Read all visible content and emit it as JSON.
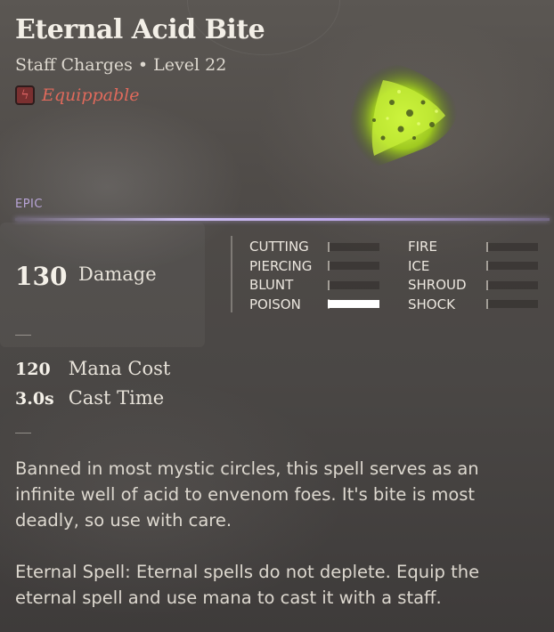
{
  "item": {
    "title": "Eternal Acid Bite",
    "subtitle": "Staff Charges • Level 22",
    "equippable_label": "Equippable",
    "rarity": "EPIC"
  },
  "damage": {
    "value": "130",
    "label": "Damage",
    "types_left": [
      {
        "label": "CUTTING",
        "fill": 0
      },
      {
        "label": "PIERCING",
        "fill": 0
      },
      {
        "label": "BLUNT",
        "fill": 0
      },
      {
        "label": "POISON",
        "fill": 1
      }
    ],
    "types_right": [
      {
        "label": "FIRE",
        "fill": 0
      },
      {
        "label": "ICE",
        "fill": 0
      },
      {
        "label": "SHROUD",
        "fill": 0
      },
      {
        "label": "SHOCK",
        "fill": 0
      }
    ]
  },
  "stats": {
    "mana_cost_value": "120",
    "mana_cost_label": "Mana Cost",
    "cast_time_value": "3.0s",
    "cast_time_label": "Cast Time"
  },
  "description": {
    "flavor": "Banned in most mystic circles, this spell serves as an infinite well of acid to envenom foes. It's bite is most deadly, so use with care.",
    "eternal": "Eternal Spell: Eternal spells do not deplete. Equip the eternal spell and use mana to cast it with a staff."
  },
  "icons": {
    "equippable": "lightning-bolt-icon",
    "spell": "acid-splash-icon"
  },
  "colors": {
    "equippable": "#e06a5c",
    "rarity": "#b9a5d8",
    "acid": "#b6e51e"
  }
}
